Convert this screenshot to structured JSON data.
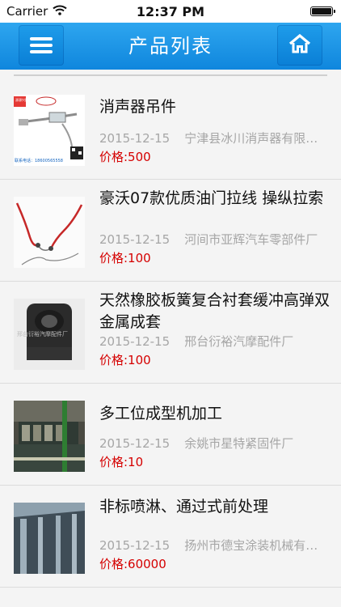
{
  "status_bar": {
    "carrier": "Carrier",
    "time": "12:37 PM"
  },
  "nav": {
    "title": "产品列表"
  },
  "products": [
    {
      "title": "消声器吊件",
      "date": "2015-12-15",
      "company": "宁津县冰川消声器有限公司",
      "price": "价格:500"
    },
    {
      "title": "豪沃07款优质油门拉线 操纵拉索",
      "date": "2015-12-15",
      "company": "河间市亚辉汽车零部件厂",
      "price": "价格:100"
    },
    {
      "title": "天然橡胶板簧复合衬套缓冲高弹双金属成套",
      "date": "2015-12-15",
      "company": "邢台衍裕汽摩配件厂",
      "price": "价格:100"
    },
    {
      "title": "多工位成型机加工",
      "date": "2015-12-15",
      "company": "余姚市星特紧固件厂",
      "price": "价格:10"
    },
    {
      "title": "非标喷淋、通过式前处理",
      "date": "2015-12-15",
      "company": "扬州市德宝涂装机械有限公司",
      "price": "价格:60000"
    }
  ],
  "thumb_text": {
    "item0_badge": "源源兴配",
    "item0_phone": "联系电话：18600565558",
    "item2_watermark": "邢台衍裕汽摩配件厂"
  }
}
